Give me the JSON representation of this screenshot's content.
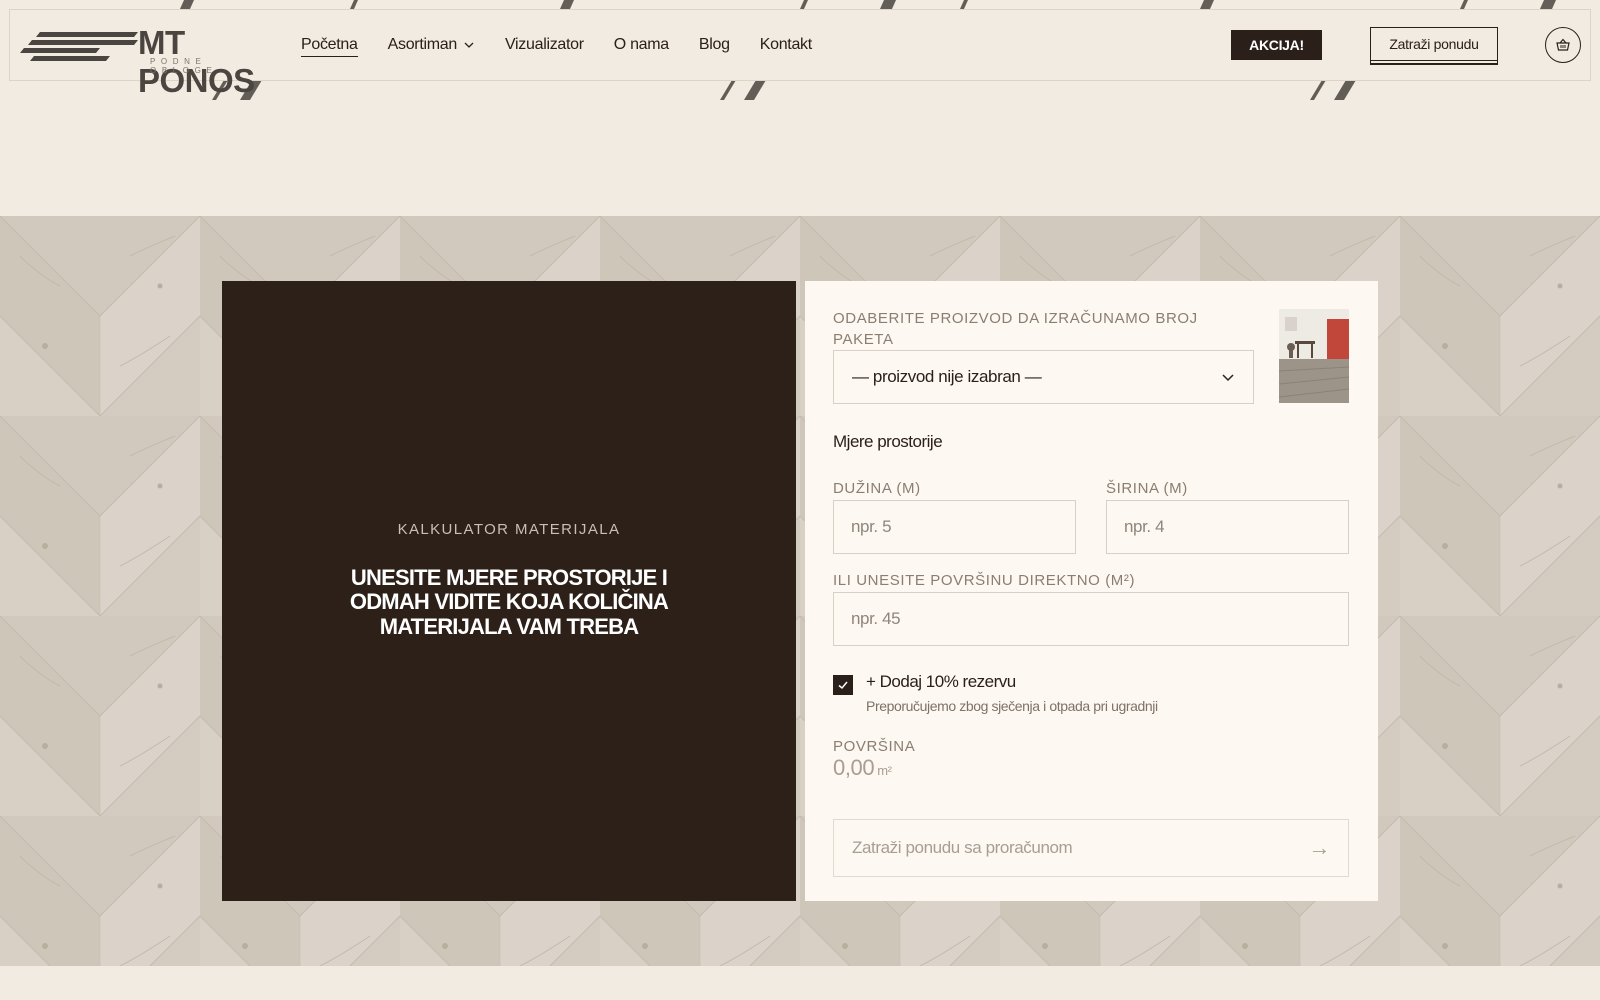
{
  "brand": {
    "name": "MT PONOS",
    "tagline": "PODNE OBLOGE"
  },
  "nav": {
    "items": [
      {
        "label": "Početna",
        "active": true
      },
      {
        "label": "Asortiman",
        "dropdown": true
      },
      {
        "label": "Vizualizator"
      },
      {
        "label": "O nama"
      },
      {
        "label": "Blog"
      },
      {
        "label": "Kontakt"
      }
    ],
    "akcija_label": "AKCIJA!",
    "offer_label": "Zatraži ponudu",
    "cart_icon": "basket-icon"
  },
  "calculator": {
    "eyebrow": "KALKULATOR MATERIJALA",
    "heading": "UNESITE MJERE PROSTORIJE I ODMAH VIDITE KOJA KOLIČINA MATERIJALA VAM TREBA",
    "product_label": "ODABERITE PROIZVOD DA IZRAČUNAMO BROJ PAKETA",
    "product_selected": "— proizvod nije izabran —",
    "room_title": "Mjere prostorije",
    "length_label": "DUŽINA (M)",
    "length_placeholder": "npr. 5",
    "width_label": "ŠIRINA (M)",
    "width_placeholder": "npr. 4",
    "area_direct_label": "ILI UNESITE POVRŠINU DIREKTNO (M²)",
    "area_direct_placeholder": "npr. 45",
    "reserve_checked": true,
    "reserve_label": "+ Dodaj 10% rezervu",
    "reserve_hint": "Preporučujemo zbog sječenja i otpada pri ugradnji",
    "area_label": "POVRŠINA",
    "area_value": "0,00",
    "area_unit": "m²",
    "submit_label": "Zatraži ponudu sa proračunom",
    "submit_arrow": "→"
  },
  "colors": {
    "background": "#f2ebe1",
    "dark": "#2c2019",
    "panel": "#fdf8f1",
    "muted": "#8a7e72"
  }
}
